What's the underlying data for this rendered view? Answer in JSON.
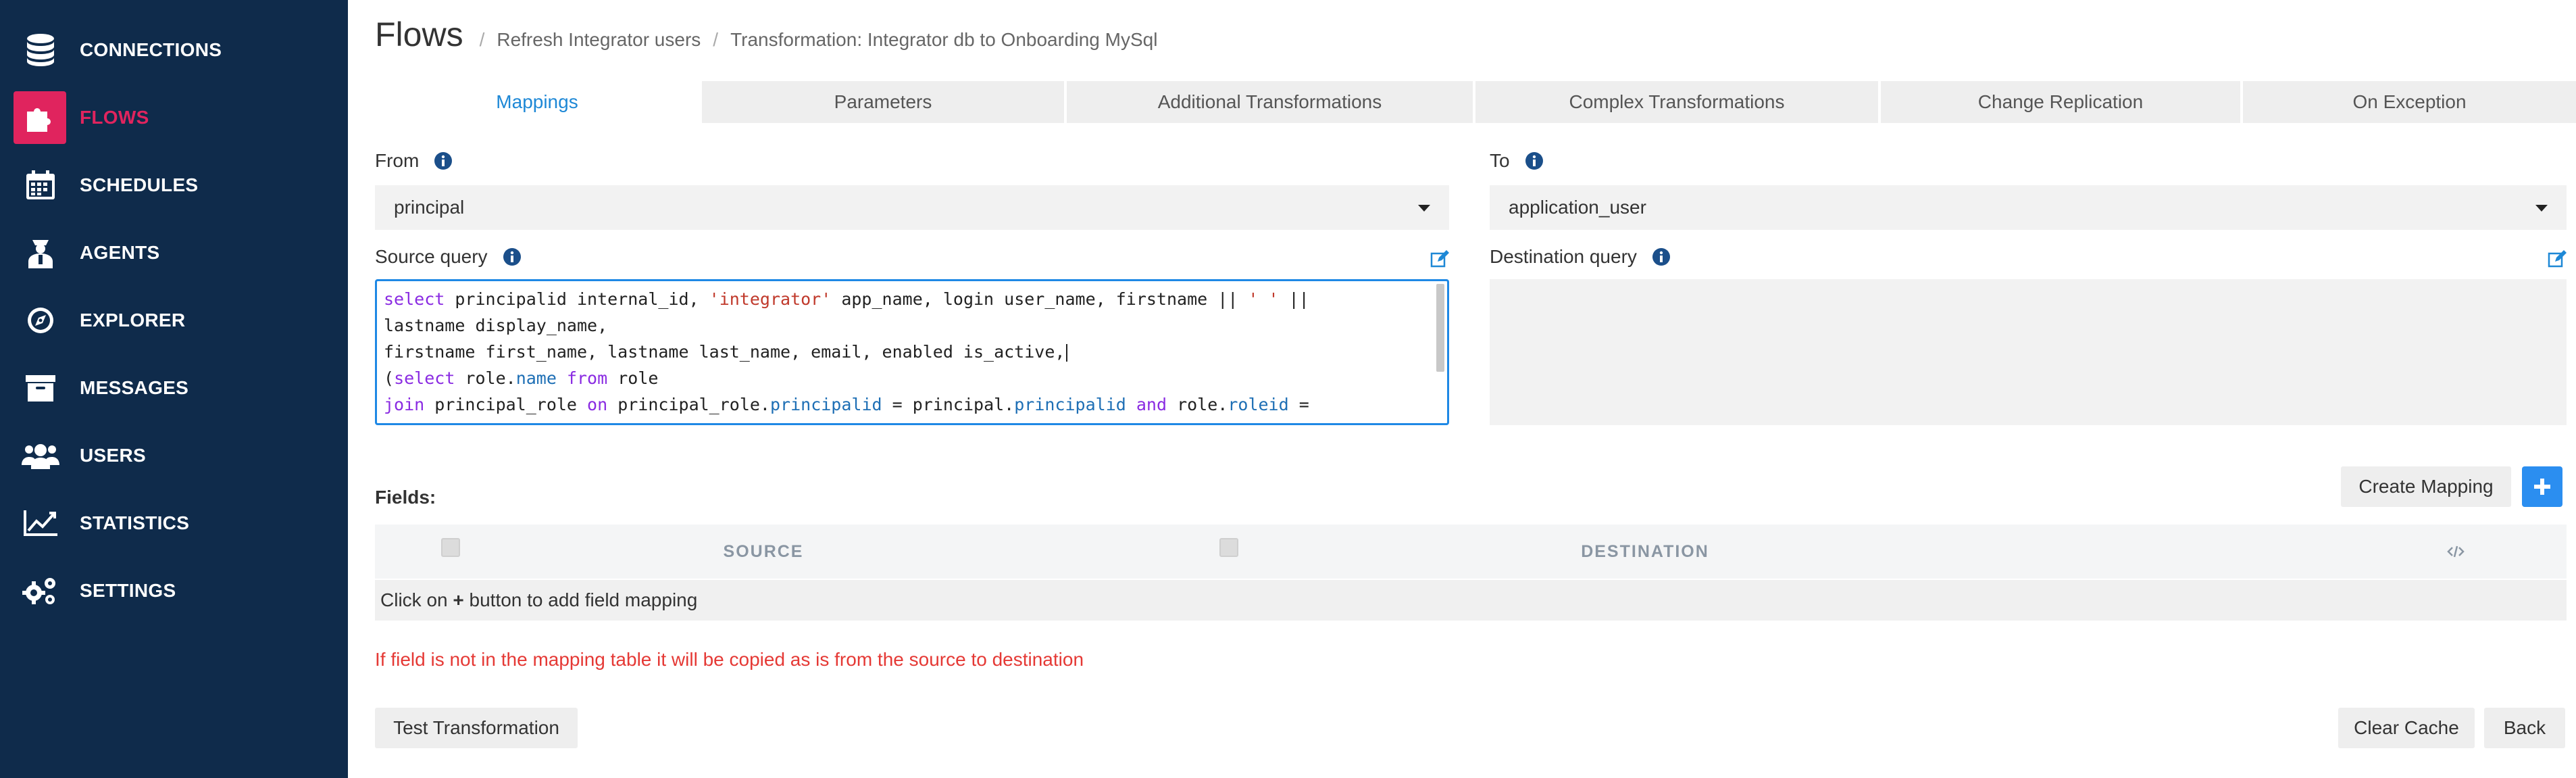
{
  "sidebar": {
    "items": [
      {
        "label": "CONNECTIONS",
        "icon": "database-icon",
        "active": false
      },
      {
        "label": "FLOWS",
        "icon": "puzzle-icon",
        "active": true
      },
      {
        "label": "SCHEDULES",
        "icon": "calendar-icon",
        "active": false
      },
      {
        "label": "AGENTS",
        "icon": "agent-icon",
        "active": false
      },
      {
        "label": "EXPLORER",
        "icon": "compass-icon",
        "active": false
      },
      {
        "label": "MESSAGES",
        "icon": "archive-icon",
        "active": false
      },
      {
        "label": "USERS",
        "icon": "users-icon",
        "active": false
      },
      {
        "label": "STATISTICS",
        "icon": "line-chart-icon",
        "active": false
      },
      {
        "label": "SETTINGS",
        "icon": "gears-icon",
        "active": false
      }
    ],
    "colors": {
      "background": "#0f2b4b",
      "active": "#e0245e"
    }
  },
  "header": {
    "title": "Flows",
    "breadcrumbs": [
      "Refresh Integrator users",
      "Transformation: Integrator db to Onboarding MySql"
    ],
    "separator": "/"
  },
  "tabs": [
    "Mappings",
    "Parameters",
    "Additional Transformations",
    "Complex Transformations",
    "Change Replication",
    "On Exception"
  ],
  "active_tab": "Mappings",
  "from": {
    "label": "From",
    "value": "principal"
  },
  "to": {
    "label": "To",
    "value": "application_user"
  },
  "source_query": {
    "label": "Source query",
    "lines": {
      "l1": {
        "kw1": "select",
        "t1": " principalid internal_id, ",
        "s1": "'integrator'",
        "t2": " app_name, login user_name, firstname || ",
        "s2": "' '",
        "t3": " ||"
      },
      "l2": {
        "t1": "lastname display_name,"
      },
      "l3": {
        "t1": "firstname first_name, lastname last_name, email, enabled is_active,"
      },
      "l4": {
        "t0": "(",
        "kw1": "select",
        "t1": " role.",
        "p1": "name",
        "kw2": " from",
        "t2": " role"
      },
      "l5": {
        "kw1": "join",
        "t1": " principal_role ",
        "kw2": "on",
        "t2": " principal_role.",
        "p1": "principalid",
        "t3": " = principal.",
        "p2": "principalid",
        "kw3": " and",
        "t4": " role.",
        "p3": "roleid",
        "t5": " ="
      }
    }
  },
  "destination_query": {
    "label": "Destination query",
    "value": ""
  },
  "fields": {
    "label": "Fields:",
    "create_mapping_label": "Create Mapping",
    "add_icon": "plus-icon",
    "columns": {
      "source": "SOURCE",
      "destination": "DESTINATION",
      "code_icon": "code-icon"
    },
    "empty_prefix": "Click on ",
    "empty_plus": "+",
    "empty_suffix": " button to add field mapping"
  },
  "warning": "If field is not in the mapping table it will be copied as is from the source to destination",
  "buttons": {
    "test": "Test Transformation",
    "clear_cache": "Clear Cache",
    "back": "Back"
  },
  "colors": {
    "accent": "#1e88d6",
    "warning": "#e53935",
    "add_button": "#2b8ef0"
  }
}
